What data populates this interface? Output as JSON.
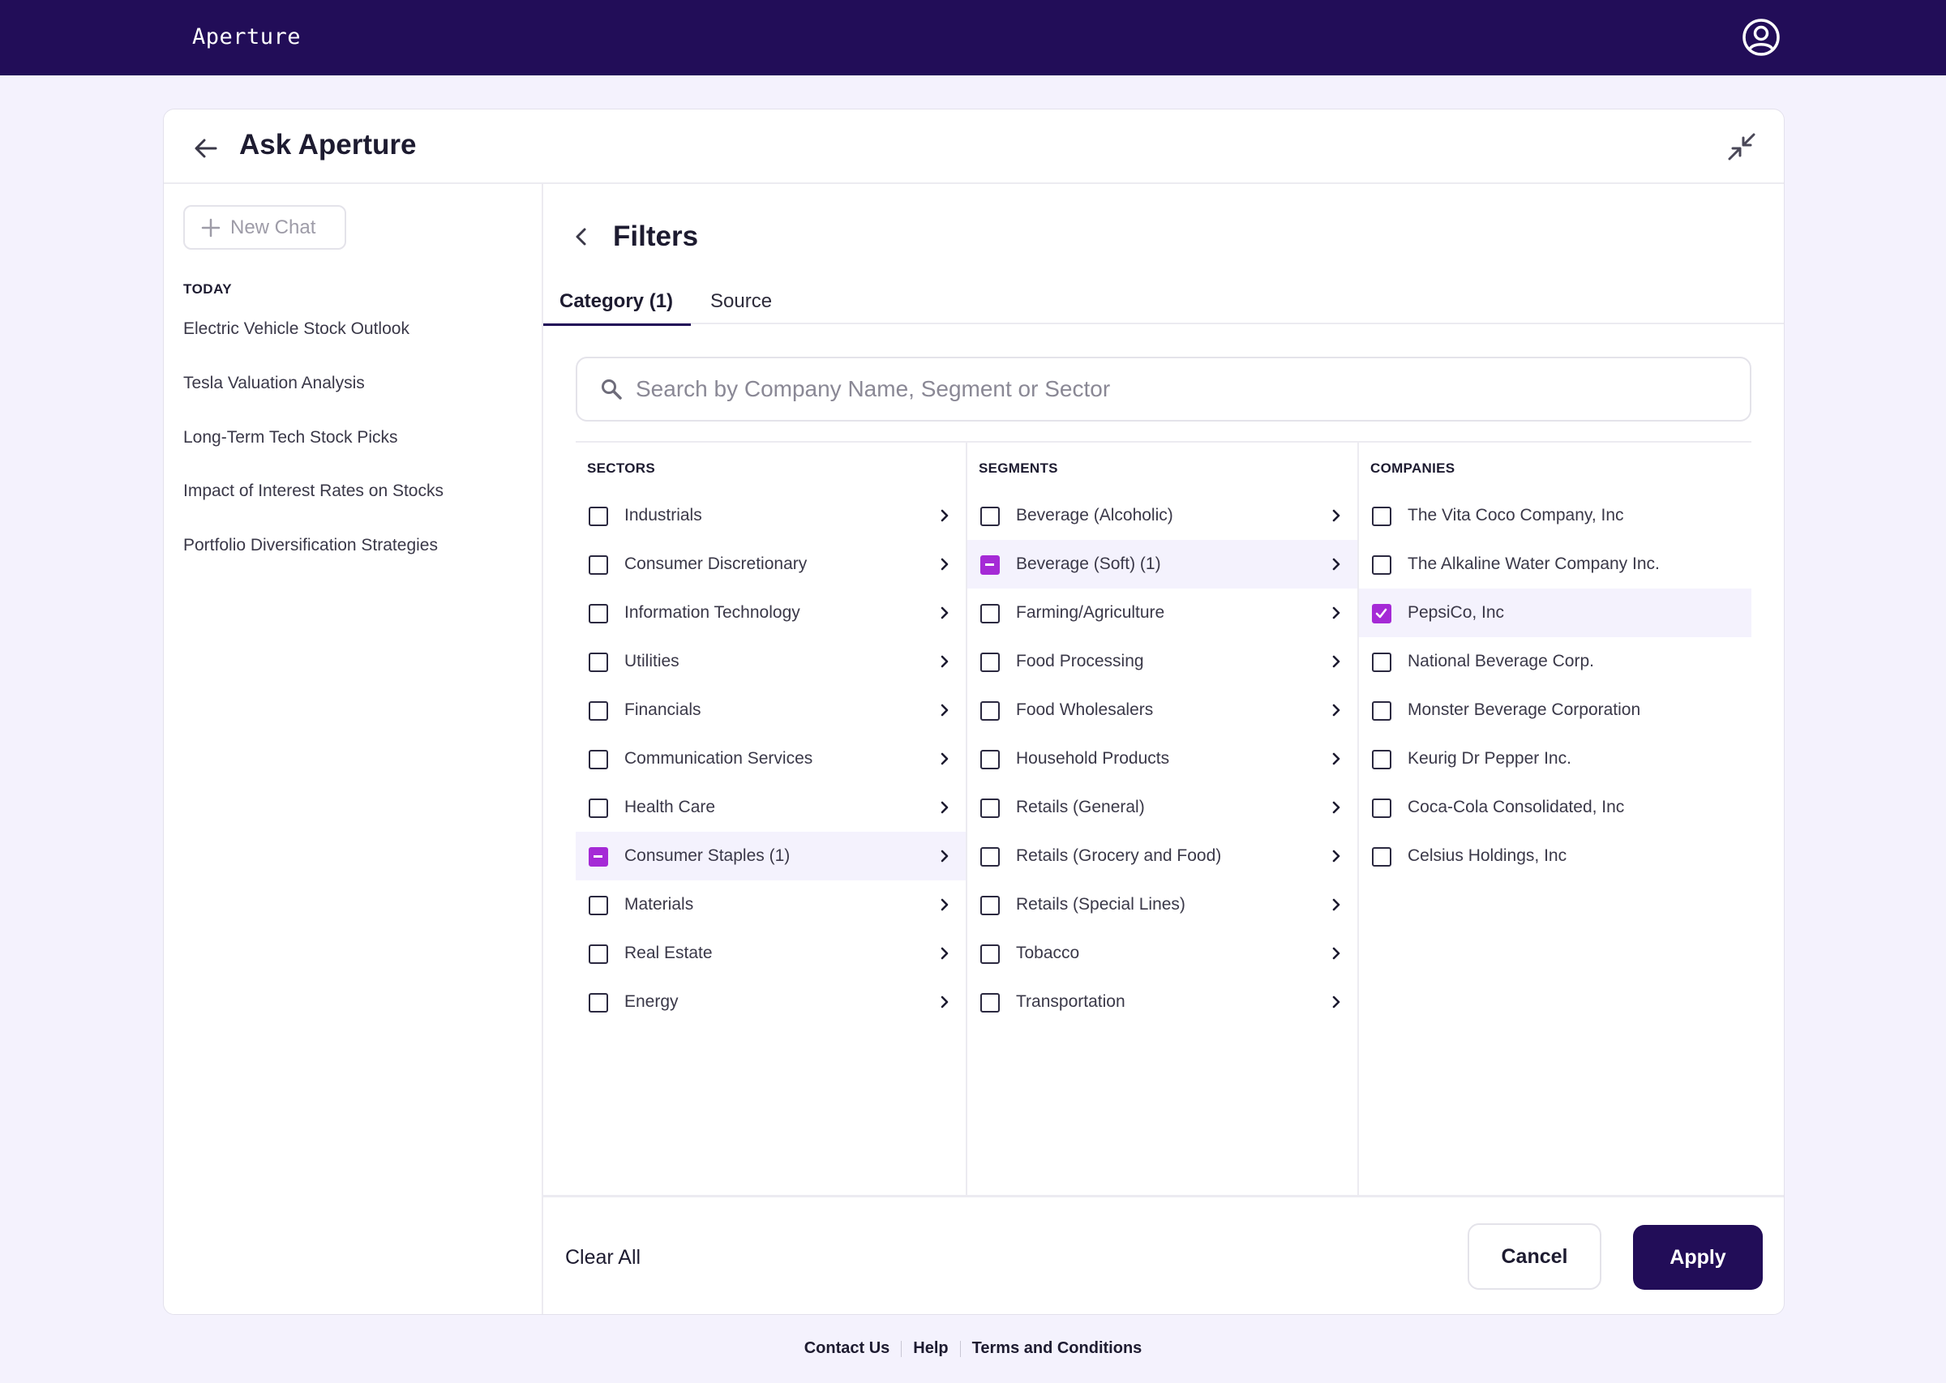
{
  "app": {
    "brand": "Aperture"
  },
  "card": {
    "title": "Ask Aperture"
  },
  "sidebar": {
    "new_chat_label": "New Chat",
    "section_label": "TODAY",
    "history": [
      "Electric Vehicle Stock Outlook",
      "Tesla Valuation Analysis",
      "Long-Term Tech Stock Picks",
      "Impact of Interest Rates on Stocks",
      "Portfolio Diversification Strategies"
    ]
  },
  "filters": {
    "title": "Filters",
    "tabs": [
      {
        "label": "Category (1)",
        "active": true
      },
      {
        "label": "Source",
        "active": false
      }
    ],
    "search": {
      "placeholder": "Search by Company Name, Segment or Sector",
      "value": ""
    },
    "sectors": {
      "heading": "SECTORS",
      "items": [
        {
          "label": "Industrials",
          "state": "unchecked"
        },
        {
          "label": "Consumer Discretionary",
          "state": "unchecked"
        },
        {
          "label": "Information Technology",
          "state": "unchecked"
        },
        {
          "label": "Utilities",
          "state": "unchecked"
        },
        {
          "label": "Financials",
          "state": "unchecked"
        },
        {
          "label": "Communication Services",
          "state": "unchecked"
        },
        {
          "label": "Health Care",
          "state": "unchecked"
        },
        {
          "label": "Consumer Staples (1)",
          "state": "partial"
        },
        {
          "label": "Materials",
          "state": "unchecked"
        },
        {
          "label": "Real Estate",
          "state": "unchecked"
        },
        {
          "label": "Energy",
          "state": "unchecked"
        }
      ]
    },
    "segments": {
      "heading": "SEGMENTS",
      "items": [
        {
          "label": "Beverage (Alcoholic)",
          "state": "unchecked"
        },
        {
          "label": "Beverage (Soft) (1)",
          "state": "partial"
        },
        {
          "label": "Farming/Agriculture",
          "state": "unchecked"
        },
        {
          "label": "Food Processing",
          "state": "unchecked"
        },
        {
          "label": "Food Wholesalers",
          "state": "unchecked"
        },
        {
          "label": "Household Products",
          "state": "unchecked"
        },
        {
          "label": "Retails (General)",
          "state": "unchecked"
        },
        {
          "label": "Retails (Grocery and Food)",
          "state": "unchecked"
        },
        {
          "label": "Retails (Special Lines)",
          "state": "unchecked"
        },
        {
          "label": "Tobacco",
          "state": "unchecked"
        },
        {
          "label": "Transportation",
          "state": "unchecked"
        }
      ]
    },
    "companies": {
      "heading": "COMPANIES",
      "items": [
        {
          "label": "The Vita Coco Company, Inc",
          "state": "unchecked"
        },
        {
          "label": "The Alkaline Water Company Inc.",
          "state": "unchecked"
        },
        {
          "label": "PepsiCo, Inc",
          "state": "checked"
        },
        {
          "label": "National Beverage Corp.",
          "state": "unchecked"
        },
        {
          "label": "Monster Beverage Corporation",
          "state": "unchecked"
        },
        {
          "label": "Keurig Dr Pepper Inc.",
          "state": "unchecked"
        },
        {
          "label": "Coca-Cola Consolidated, Inc",
          "state": "unchecked"
        },
        {
          "label": "Celsius Holdings, Inc",
          "state": "unchecked"
        }
      ]
    },
    "actions": {
      "clear_all": "Clear All",
      "cancel": "Cancel",
      "apply": "Apply"
    }
  },
  "footer": {
    "links": [
      "Contact Us",
      "Help",
      "Terms and Conditions"
    ]
  },
  "colors": {
    "primary": "#220d58",
    "accent": "#a52ad6",
    "page_bg": "#f4f2fd",
    "highlight_row": "#f4f2fd"
  }
}
